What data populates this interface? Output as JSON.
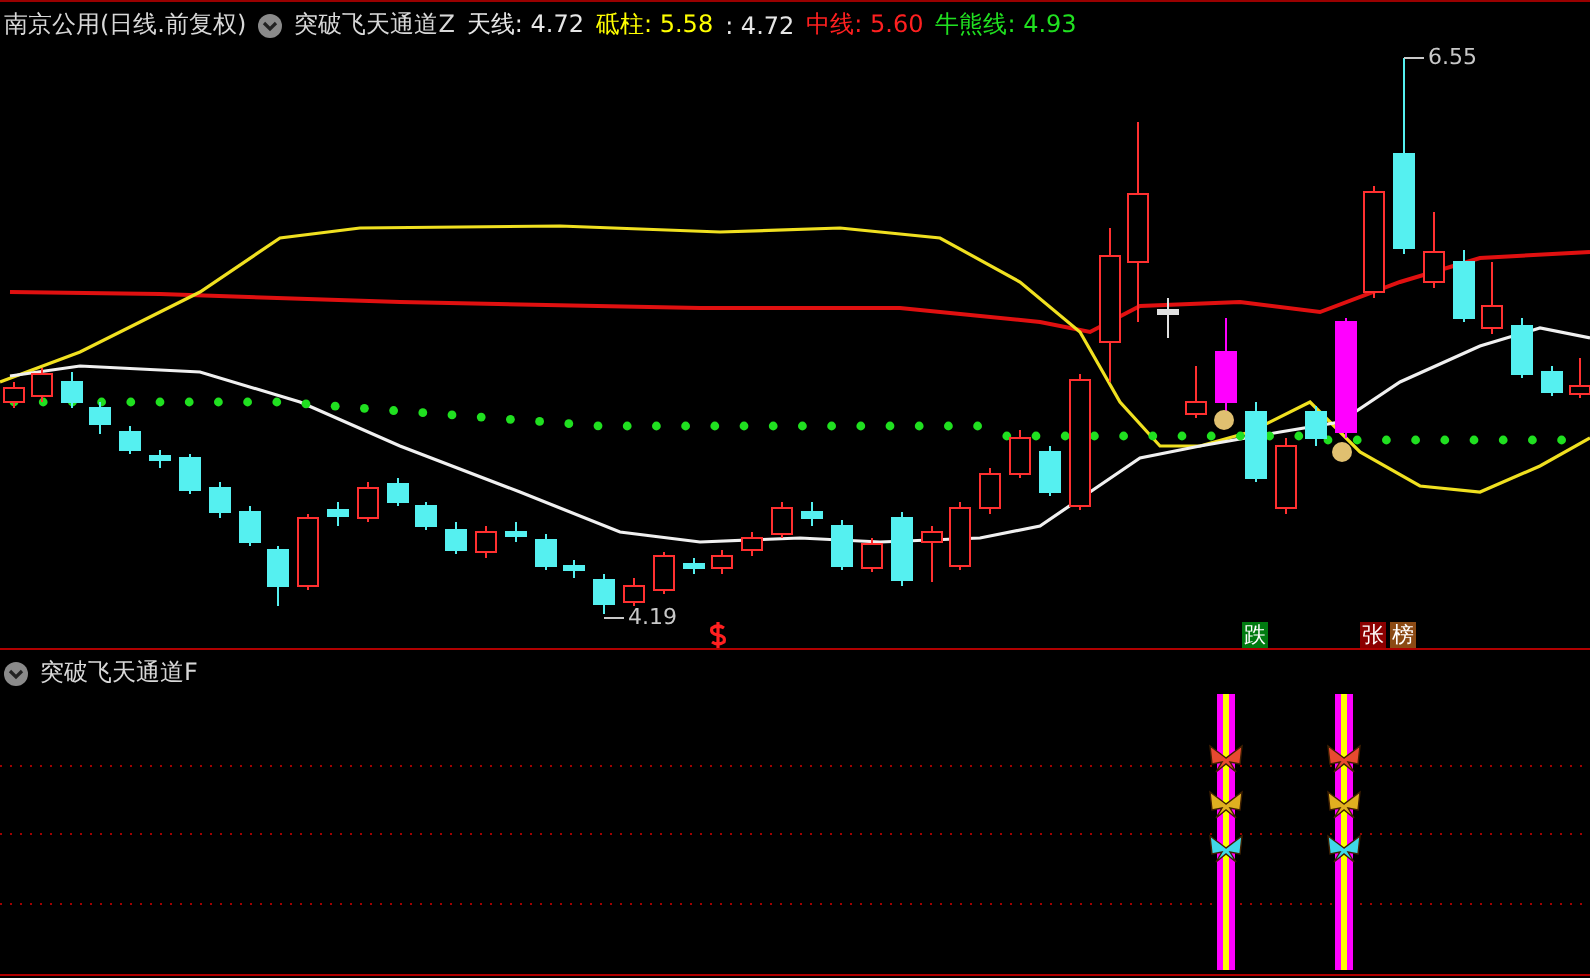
{
  "main_panel": {
    "stock_title": "南京公用(日线.前复权)",
    "indicator_name": "突破飞天通道Z",
    "readings": [
      {
        "text": "天线: 4.72",
        "color": "#e6e6e6"
      },
      {
        "text": "砥柱: 5.58",
        "color": "#ffff00"
      },
      {
        "text": ": 4.72",
        "color": "#e6e6e6"
      },
      {
        "text": "中线: 5.60",
        "color": "#ff2020"
      },
      {
        "text": "牛熊线: 4.93",
        "color": "#20e020"
      }
    ],
    "price_labels": [
      {
        "kind": "high",
        "text": "6.55"
      },
      {
        "kind": "low",
        "text": "4.19"
      }
    ],
    "signals": [
      {
        "text": "跌",
        "color": "#007a10"
      },
      {
        "text": "张",
        "color": "#8b0000"
      },
      {
        "text": "榜",
        "color": "#8b4a14"
      }
    ]
  },
  "sub_panel": {
    "indicator_name": "突破飞天通道F"
  }
}
